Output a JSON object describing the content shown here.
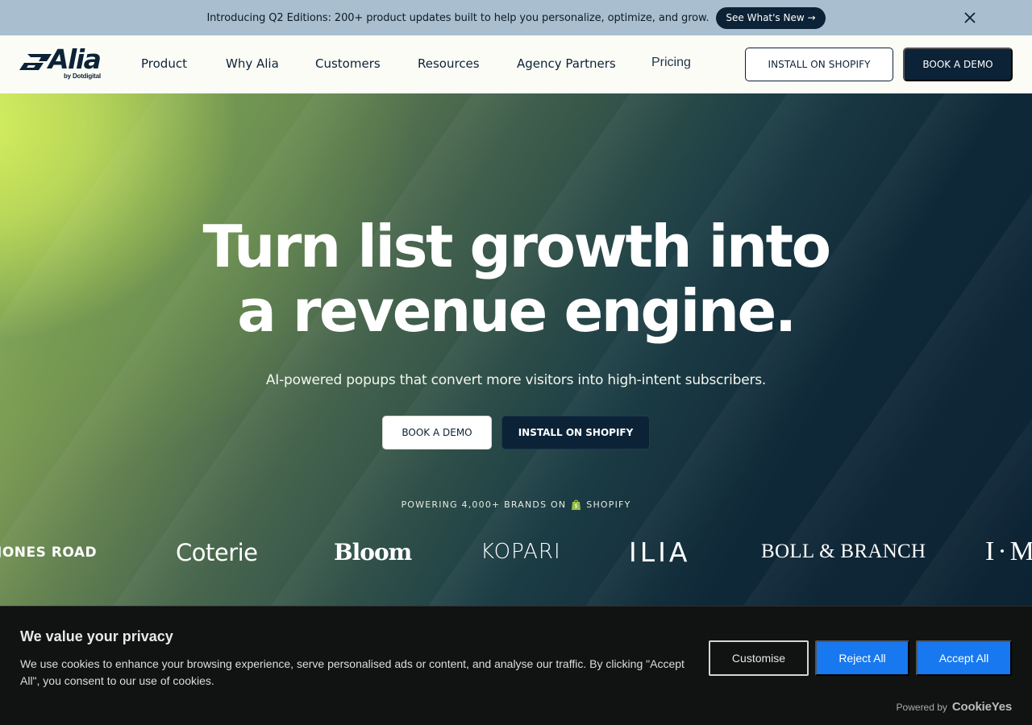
{
  "announcement": {
    "text": "Introducing Q2 Editions: 200+ product updates built to help you personalize, optimize, and grow.",
    "cta": "See What's New →"
  },
  "nav": {
    "logo_text": "Alia",
    "logo_sub": "by Dotdigital",
    "links": [
      "Product",
      "Why Alia",
      "Customers",
      "Resources",
      "Agency Partners",
      "Pricing"
    ],
    "install": "INSTALL ON SHOPIFY",
    "demo": "BOOK A DEMO"
  },
  "hero": {
    "title_line1": "Turn list growth into",
    "title_line2": "a revenue engine.",
    "subtitle": "AI-powered popups that convert more visitors into high-intent subscribers.",
    "demo": "BOOK A DEMO",
    "install": "INSTALL ON SHOPIFY",
    "powering": "POWERING 4,000+ BRANDS ON",
    "shopify": "SHOPIFY",
    "brands": [
      "JONES ROAD",
      "Coterie",
      "Bloom",
      "KOPARI",
      "ILIA",
      "BOLL & BRANCH",
      "I·M"
    ]
  },
  "cookie": {
    "title": "We value your privacy",
    "text": "We use cookies to enhance your browsing experience, serve personalised ads or content, and analyse our traffic. By clicking \"Accept All\", you consent to our use of cookies.",
    "customise": "Customise",
    "reject": "Reject All",
    "accept": "Accept All",
    "powered_by": "Powered by",
    "provider": "CookieYes"
  },
  "colors": {
    "navy": "#0c2236",
    "announce_bg": "#a9bfcf",
    "cookie_blue": "#1878f0",
    "hero_lime": "#d6f05a"
  }
}
